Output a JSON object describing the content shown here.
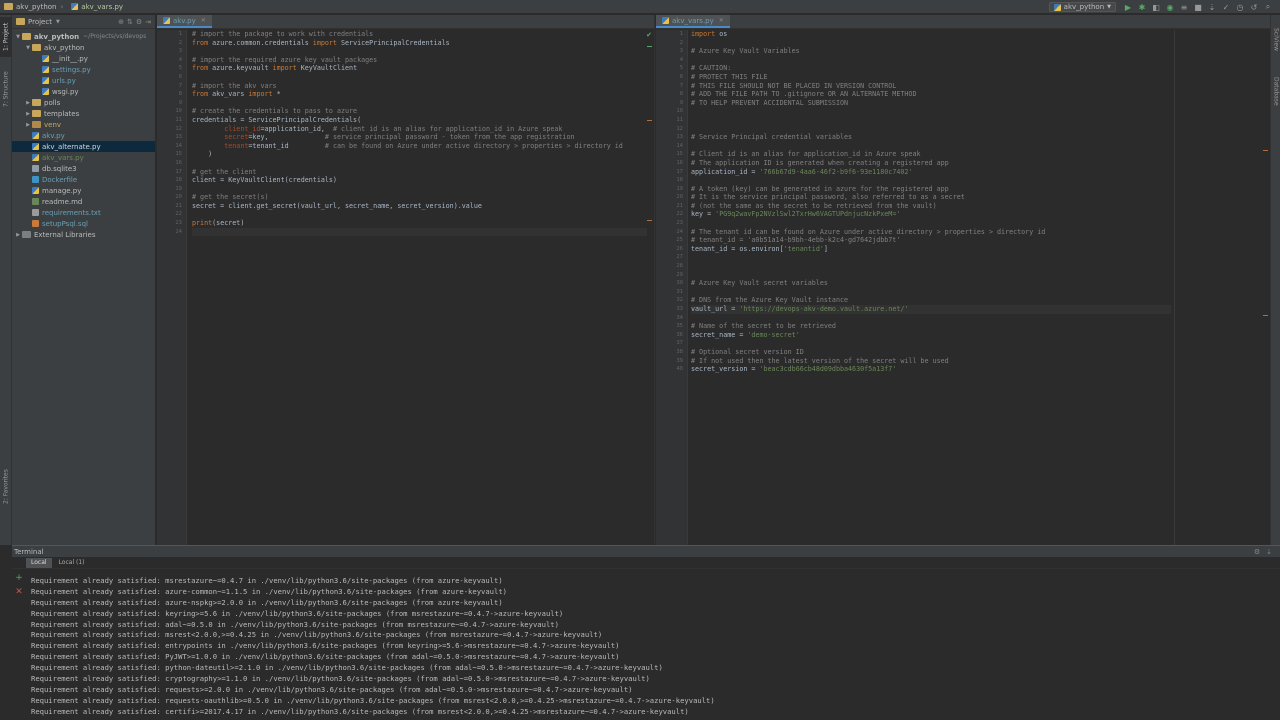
{
  "navbar": {
    "project": "akv_python",
    "file": "akv_vars.py",
    "run_config": "akv_python"
  },
  "left_stripe": {
    "project_tab": "1: Project",
    "structure_tab": "7: Structure",
    "favorites_tab": "2: Favorites"
  },
  "right_stripe": {
    "sciview_tab": "SciView",
    "database_tab": "Database"
  },
  "project_pane": {
    "title": "Project",
    "tree": [
      {
        "label": "akv_python",
        "path": "~/Projects/vs/devops",
        "indent": 0,
        "arrow": "▼",
        "icon": "folder",
        "bold": true
      },
      {
        "label": "akv_python",
        "indent": 1,
        "arrow": "▼",
        "icon": "folder"
      },
      {
        "label": "__init__.py",
        "indent": 2,
        "arrow": "",
        "icon": "py"
      },
      {
        "label": "settings.py",
        "indent": 2,
        "arrow": "",
        "icon": "py",
        "color": "#6a9fb5"
      },
      {
        "label": "urls.py",
        "indent": 2,
        "arrow": "",
        "icon": "py",
        "color": "#6a9fb5"
      },
      {
        "label": "wsgi.py",
        "indent": 2,
        "arrow": "",
        "icon": "py"
      },
      {
        "label": "polls",
        "indent": 1,
        "arrow": "▶",
        "icon": "folder"
      },
      {
        "label": "templates",
        "indent": 1,
        "arrow": "▶",
        "icon": "folder"
      },
      {
        "label": "venv",
        "indent": 1,
        "arrow": "▶",
        "icon": "folder-ex",
        "color": "#c9a75a"
      },
      {
        "label": "akv.py",
        "indent": 1,
        "arrow": "",
        "icon": "py",
        "color": "#6a9fb5"
      },
      {
        "label": "akv_alternate.py",
        "indent": 1,
        "arrow": "",
        "icon": "py",
        "selected": true
      },
      {
        "label": "akv_vars.py",
        "indent": 1,
        "arrow": "",
        "icon": "py",
        "color": "#6a8759"
      },
      {
        "label": "db.sqlite3",
        "indent": 1,
        "arrow": "",
        "icon": "db"
      },
      {
        "label": "Dockerfile",
        "indent": 1,
        "arrow": "",
        "icon": "docker",
        "color": "#6a9fb5"
      },
      {
        "label": "manage.py",
        "indent": 1,
        "arrow": "",
        "icon": "py"
      },
      {
        "label": "readme.md",
        "indent": 1,
        "arrow": "",
        "icon": "md"
      },
      {
        "label": "requirements.txt",
        "indent": 1,
        "arrow": "",
        "icon": "txt",
        "color": "#6a9fb5"
      },
      {
        "label": "setupPsql.sql",
        "indent": 1,
        "arrow": "",
        "icon": "sql",
        "color": "#6a9fb5"
      },
      {
        "label": "External Libraries",
        "indent": 0,
        "arrow": "▶",
        "icon": "lib"
      }
    ]
  },
  "editor_left": {
    "tab": "akv.py",
    "lines": [
      [
        [
          "c-com",
          "# import the package to work with credentials"
        ]
      ],
      [
        [
          "c-key",
          "from "
        ],
        [
          "c-def",
          "azure.common.credentials "
        ],
        [
          "c-key",
          "import "
        ],
        [
          "c-def",
          "ServicePrincipalCredentials"
        ]
      ],
      [],
      [
        [
          "c-com",
          "# import the required azure key vault packages"
        ]
      ],
      [
        [
          "c-key",
          "from "
        ],
        [
          "c-def",
          "azure.keyvault "
        ],
        [
          "c-key",
          "import "
        ],
        [
          "c-def",
          "KeyVaultClient"
        ]
      ],
      [],
      [
        [
          "c-com",
          "# import the akv vars"
        ]
      ],
      [
        [
          "c-key",
          "from "
        ],
        [
          "c-def",
          "akv_vars "
        ],
        [
          "c-key",
          "import "
        ],
        [
          "c-def",
          "*"
        ]
      ],
      [],
      [
        [
          "c-com",
          "# create the credentials to pass to azure"
        ]
      ],
      [
        [
          "c-def",
          "credentials = ServicePrincipalCredentials("
        ]
      ],
      [
        [
          "c-def",
          "        "
        ],
        [
          "c-prm",
          "client_id"
        ],
        [
          "c-def",
          "=application_id,  "
        ],
        [
          "c-com",
          "# client id is an alias for application_id in Azure speak"
        ]
      ],
      [
        [
          "c-def",
          "        "
        ],
        [
          "c-prm",
          "secret"
        ],
        [
          "c-def",
          "=key,              "
        ],
        [
          "c-com",
          "# service principal password - token from the app registration"
        ]
      ],
      [
        [
          "c-def",
          "        "
        ],
        [
          "c-prm",
          "tenant"
        ],
        [
          "c-def",
          "=tenant_id         "
        ],
        [
          "c-com",
          "# can be found on Azure under active directory > properties > directory id"
        ]
      ],
      [
        [
          "c-def",
          "    )"
        ]
      ],
      [],
      [
        [
          "c-com",
          "# get the client"
        ]
      ],
      [
        [
          "c-def",
          "client = KeyVaultClient(credentials)"
        ]
      ],
      [],
      [
        [
          "c-com",
          "# get the secret(s)"
        ]
      ],
      [
        [
          "c-def",
          "secret = client.get_secret(vault_url, secret_name, secret_version).value"
        ]
      ],
      [],
      [
        [
          "c-key",
          "print"
        ],
        [
          "c-def",
          "(secret)"
        ]
      ],
      []
    ]
  },
  "editor_right": {
    "tab": "akv_vars.py",
    "lines": [
      [
        [
          "c-key",
          "import "
        ],
        [
          "c-def",
          "os"
        ]
      ],
      [],
      [
        [
          "c-com",
          "# Azure Key Vault Variables"
        ]
      ],
      [],
      [
        [
          "c-com",
          "# CAUTION:"
        ]
      ],
      [
        [
          "c-com",
          "# PROTECT THIS FILE"
        ]
      ],
      [
        [
          "c-com",
          "# THIS FILE SHOULD NOT BE PLACED IN VERSION CONTROL"
        ]
      ],
      [
        [
          "c-com",
          "# ADD THE FILE PATH TO .gitignore OR AN ALTERNATE METHOD"
        ]
      ],
      [
        [
          "c-com",
          "# TO HELP PREVENT ACCIDENTAL SUBMISSION"
        ]
      ],
      [],
      [],
      [],
      [
        [
          "c-com",
          "# Service Principal credential variables"
        ]
      ],
      [],
      [
        [
          "c-com",
          "# Client id is an alias for application_id in Azure speak"
        ]
      ],
      [
        [
          "c-com",
          "# The application ID is generated when creating a registered app"
        ]
      ],
      [
        [
          "c-def",
          "application_id = "
        ],
        [
          "c-str",
          "'766b67d9-4aa6-46f2-b9f6-93e1180c7402'"
        ]
      ],
      [],
      [
        [
          "c-com",
          "# A token (key) can be generated in azure for the registered app"
        ]
      ],
      [
        [
          "c-com",
          "# It is the service principal password, also referred to as a secret"
        ]
      ],
      [
        [
          "c-com",
          "# (not the same as the secret to be retrieved from the vault)"
        ]
      ],
      [
        [
          "c-def",
          "key = "
        ],
        [
          "c-str",
          "'PG9q2wavFp2NVzlSwl2TxrHw6VAGTUPdnjucNzkPxeM='"
        ]
      ],
      [],
      [
        [
          "c-com",
          "# The tenant id can be found on Azure under active directory > properties > directory id"
        ]
      ],
      [
        [
          "c-com",
          "# tenant_id = 'a0b51a14-b9bh-4ebb-k2c4-gd7642jdbb7t'"
        ]
      ],
      [
        [
          "c-def",
          "tenant_id = os.environ["
        ],
        [
          "c-str",
          "'tenantid'"
        ],
        [
          "c-def",
          "]"
        ]
      ],
      [],
      [],
      [],
      [
        [
          "c-com",
          "# Azure Key Vault secret variables"
        ]
      ],
      [],
      [
        [
          "c-com",
          "# DNS from the Azure Key Vault instance"
        ]
      ],
      [
        [
          "c-def",
          "vault_url = "
        ],
        [
          "c-str",
          "'https://devops-akv-demo.vault.azure.net/'"
        ]
      ],
      [],
      [
        [
          "c-com",
          "# Name of the secret to be retrieved"
        ]
      ],
      [
        [
          "c-def",
          "secret_name = "
        ],
        [
          "c-str",
          "'demo-secret'"
        ]
      ],
      [],
      [
        [
          "c-com",
          "# Optional secret version ID"
        ]
      ],
      [
        [
          "c-com",
          "# If not used then the latest version of the secret will be used"
        ]
      ],
      [
        [
          "c-def",
          "secret_version = "
        ],
        [
          "c-str",
          "'beac3cdb66cb48d09dbba4630f5a13f7'"
        ]
      ]
    ]
  },
  "terminal": {
    "title": "Terminal",
    "tabs": [
      "Local",
      "Local (1)"
    ],
    "output": [
      "Requirement already satisfied: msrestazure~=0.4.7 in ./venv/lib/python3.6/site-packages (from azure-keyvault)",
      "Requirement already satisfied: azure-common~=1.1.5 in ./venv/lib/python3.6/site-packages (from azure-keyvault)",
      "Requirement already satisfied: azure-nspkg>=2.0.0 in ./venv/lib/python3.6/site-packages (from azure-keyvault)",
      "Requirement already satisfied: keyring>=5.6 in ./venv/lib/python3.6/site-packages (from msrestazure~=0.4.7->azure-keyvault)",
      "Requirement already satisfied: adal~=0.5.0 in ./venv/lib/python3.6/site-packages (from msrestazure~=0.4.7->azure-keyvault)",
      "Requirement already satisfied: msrest<2.0.0,>=0.4.25 in ./venv/lib/python3.6/site-packages (from msrestazure~=0.4.7->azure-keyvault)",
      "Requirement already satisfied: entrypoints in ./venv/lib/python3.6/site-packages (from keyring>=5.6->msrestazure~=0.4.7->azure-keyvault)",
      "Requirement already satisfied: PyJWT>=1.0.0 in ./venv/lib/python3.6/site-packages (from adal~=0.5.0->msrestazure~=0.4.7->azure-keyvault)",
      "Requirement already satisfied: python-dateutil>=2.1.0 in ./venv/lib/python3.6/site-packages (from adal~=0.5.0->msrestazure~=0.4.7->azure-keyvault)",
      "Requirement already satisfied: cryptography>=1.1.0 in ./venv/lib/python3.6/site-packages (from adal~=0.5.0->msrestazure~=0.4.7->azure-keyvault)",
      "Requirement already satisfied: requests>=2.0.0 in ./venv/lib/python3.6/site-packages (from adal~=0.5.0->msrestazure~=0.4.7->azure-keyvault)",
      "Requirement already satisfied: requests-oauthlib>=0.5.0 in ./venv/lib/python3.6/site-packages (from msrest<2.0.0,>=0.4.25->msrestazure~=0.4.7->azure-keyvault)",
      "Requirement already satisfied: certifi>=2017.4.17 in ./venv/lib/python3.6/site-packages (from msrest<2.0.0,>=0.4.25->msrestazure~=0.4.7->azure-keyvault)"
    ]
  },
  "colors": {
    "accent": "#4a88c7",
    "keyword": "#cc7832",
    "comment": "#808080",
    "string": "#6a8759",
    "param": "#aa4926"
  },
  "icons": {
    "run": "play-icon",
    "debug": "bug-icon",
    "add": "plus-icon",
    "close": "close-icon",
    "settings": "gear-icon"
  }
}
